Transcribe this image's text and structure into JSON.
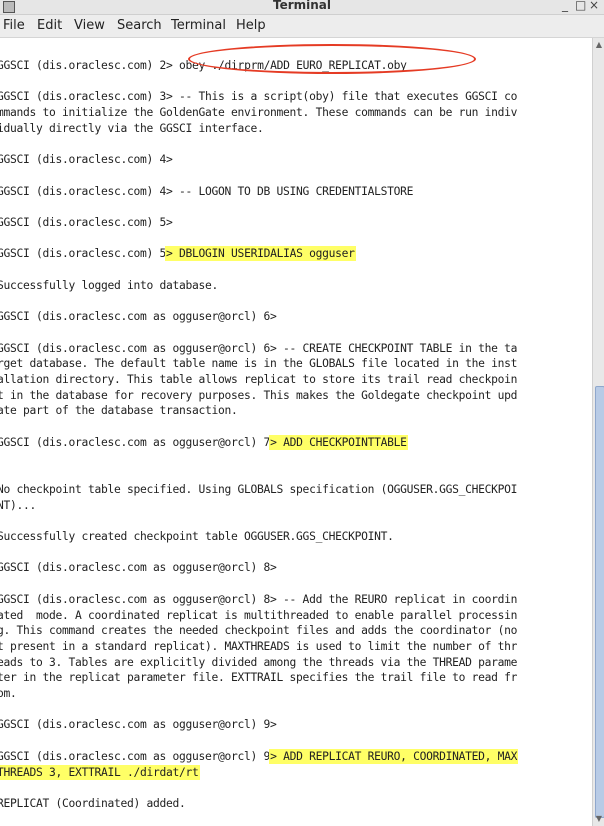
{
  "window": {
    "title": "Terminal",
    "minimize": "_",
    "maximize": "□",
    "close": "×"
  },
  "menu": [
    "File",
    "Edit",
    "View",
    "Search",
    "Terminal",
    "Help"
  ],
  "terminal": {
    "lines": [
      {
        "text": "GGSCI (dis.oraclesc.com) 2",
        "hl": "> obey ./dirprm/ADD_EURO_REPLICAT.oby",
        "circled": true
      },
      {
        "text": "",
        "hl": ""
      },
      {
        "text": "GGSCI (dis.oraclesc.com) 3> -- This is a script(oby) file that executes GGSCI co",
        "hl": ""
      },
      {
        "text": "mmands to initialize the GoldenGate environment. These commands can be run indiv",
        "hl": ""
      },
      {
        "text": "idually directly via the GGSCI interface.",
        "hl": ""
      },
      {
        "text": "",
        "hl": ""
      },
      {
        "text": "GGSCI (dis.oraclesc.com) 4>",
        "hl": ""
      },
      {
        "text": "",
        "hl": ""
      },
      {
        "text": "GGSCI (dis.oraclesc.com) 4> -- LOGON TO DB USING CREDENTIALSTORE",
        "hl": ""
      },
      {
        "text": "",
        "hl": ""
      },
      {
        "text": "GGSCI (dis.oraclesc.com) 5>",
        "hl": ""
      },
      {
        "text": "",
        "hl": ""
      },
      {
        "text": "GGSCI (dis.oraclesc.com) 5",
        "hl": "> DBLOGIN USERIDALIAS ogguser"
      },
      {
        "text": "",
        "hl": ""
      },
      {
        "text": "Successfully logged into database.",
        "hl": ""
      },
      {
        "text": "",
        "hl": ""
      },
      {
        "text": "GGSCI (dis.oraclesc.com as ogguser@orcl) 6>",
        "hl": ""
      },
      {
        "text": "",
        "hl": ""
      },
      {
        "text": "GGSCI (dis.oraclesc.com as ogguser@orcl) 6> -- CREATE CHECKPOINT TABLE in the ta",
        "hl": ""
      },
      {
        "text": "rget database. The default table name is in the GLOBALS file located in the inst",
        "hl": ""
      },
      {
        "text": "allation directory. This table allows replicat to store its trail read checkpoin",
        "hl": ""
      },
      {
        "text": "t in the database for recovery purposes. This makes the Goldegate checkpoint upd",
        "hl": ""
      },
      {
        "text": "ate part of the database transaction.",
        "hl": ""
      },
      {
        "text": "",
        "hl": ""
      },
      {
        "text": "GGSCI (dis.oraclesc.com as ogguser@orcl) 7",
        "hl": "> ADD CHECKPOINTTABLE"
      },
      {
        "text": "",
        "hl": ""
      },
      {
        "text": "",
        "hl": ""
      },
      {
        "text": "No checkpoint table specified. Using GLOBALS specification (OGGUSER.GGS_CHECKPOI",
        "hl": ""
      },
      {
        "text": "NT)...",
        "hl": ""
      },
      {
        "text": "",
        "hl": ""
      },
      {
        "text": "Successfully created checkpoint table OGGUSER.GGS_CHECKPOINT.",
        "hl": ""
      },
      {
        "text": "",
        "hl": ""
      },
      {
        "text": "GGSCI (dis.oraclesc.com as ogguser@orcl) 8>",
        "hl": ""
      },
      {
        "text": "",
        "hl": ""
      },
      {
        "text": "GGSCI (dis.oraclesc.com as ogguser@orcl) 8> -- Add the REURO replicat in coordin",
        "hl": ""
      },
      {
        "text": "ated  mode. A coordinated replicat is multithreaded to enable parallel processin",
        "hl": ""
      },
      {
        "text": "g. This command creates the needed checkpoint files and adds the coordinator (no",
        "hl": ""
      },
      {
        "text": "t present in a standard replicat). MAXTHREADS is used to limit the number of thr",
        "hl": ""
      },
      {
        "text": "eads to 3. Tables are explicitly divided among the threads via the THREAD parame",
        "hl": ""
      },
      {
        "text": "ter in the replicat parameter file. EXTTRAIL specifies the trail file to read fr",
        "hl": ""
      },
      {
        "text": "om.",
        "hl": ""
      },
      {
        "text": "",
        "hl": ""
      },
      {
        "text": "GGSCI (dis.oraclesc.com as ogguser@orcl) 9>",
        "hl": ""
      },
      {
        "text": "",
        "hl": ""
      },
      {
        "text": "GGSCI (dis.oraclesc.com as ogguser@orcl) 9",
        "hl": "> ADD REPLICAT REURO, COORDINATED, MAX"
      },
      {
        "text": "",
        "hl": "THREADS 3, EXTTRAIL ./dirdat/rt"
      },
      {
        "text": "",
        "hl": ""
      },
      {
        "text": "REPLICAT (Coordinated) added.",
        "hl": ""
      }
    ]
  },
  "colors": {
    "highlight": "#ffff66",
    "circle": "#e53b24",
    "scroll_thumb": "#b8cbe6"
  }
}
